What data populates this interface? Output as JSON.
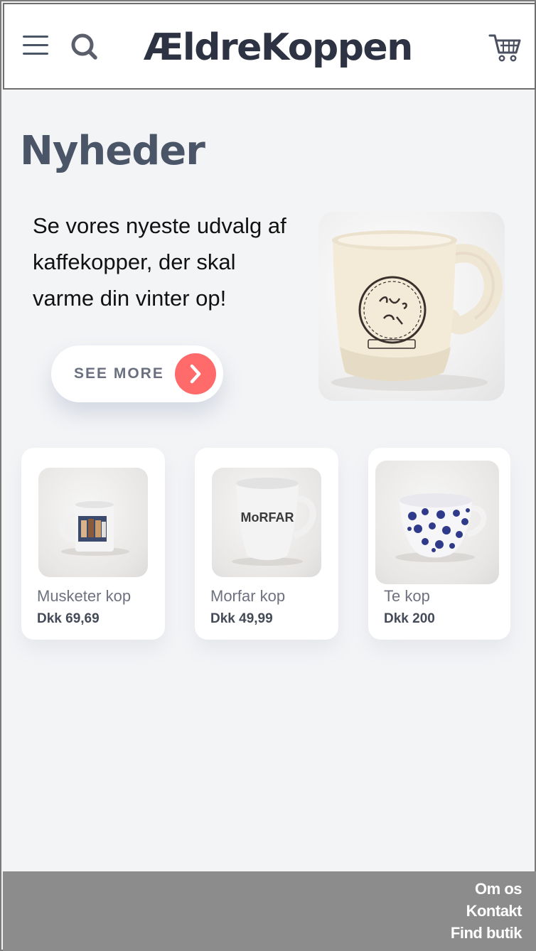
{
  "header": {
    "logo": "ÆldreKoppen",
    "menu_icon": "hamburger-menu-icon",
    "search_icon": "search-icon",
    "cart_icon": "shopping-cart-icon"
  },
  "hero": {
    "title": "Nyheder",
    "text": "Se vores nyeste udvalg af kaffekopper, der skal varme din vinter op!",
    "button_label": "SEE MORE",
    "button_icon": "chevron-right-icon",
    "accent_color": "#ff6b6b"
  },
  "products": [
    {
      "name": "Musketer kop",
      "price": "Dkk 69,69"
    },
    {
      "name": "Morfar kop",
      "price": "Dkk 49,99",
      "mug_print": "MoRFAR"
    },
    {
      "name": "Te kop",
      "price": "Dkk 200"
    }
  ],
  "footer": {
    "links": [
      "Om os",
      "Kontakt",
      "Find butik"
    ]
  }
}
